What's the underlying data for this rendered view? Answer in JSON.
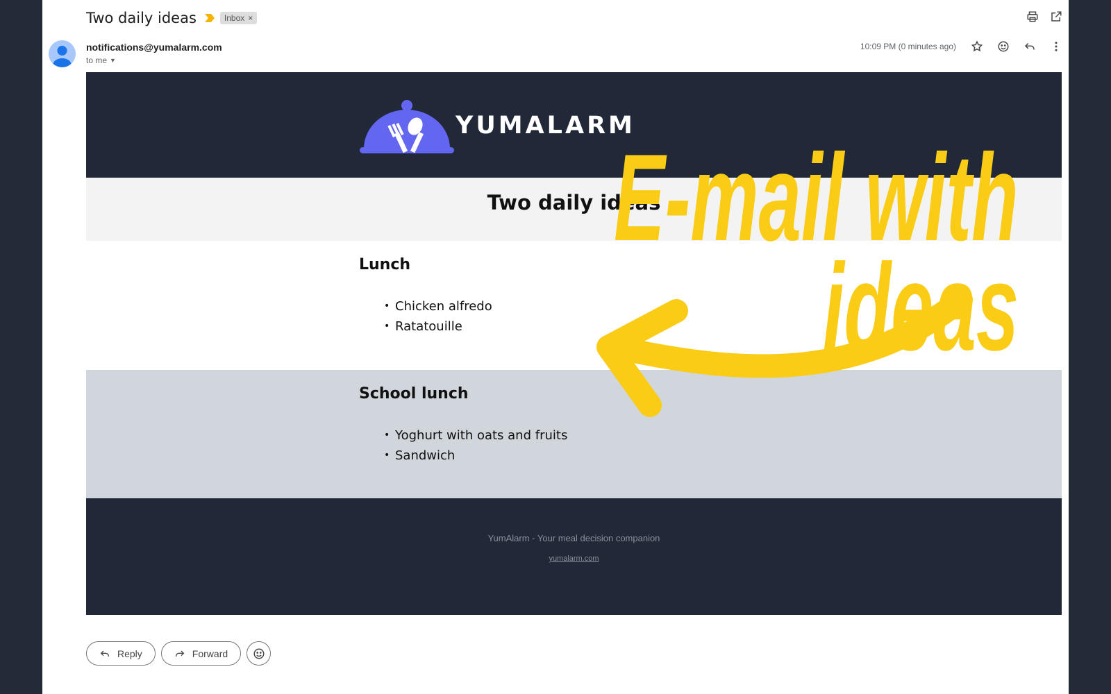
{
  "header": {
    "subject": "Two daily ideas",
    "label": "Inbox",
    "label_close": "×"
  },
  "sender": {
    "email": "notifications@yumalarm.com",
    "to": "to me",
    "timestamp": "10:09 PM (0 minutes ago)"
  },
  "email": {
    "brand": "YUMALARM",
    "title": "Two daily ideas",
    "sections": [
      {
        "heading": "Lunch",
        "items": [
          "Chicken alfredo",
          "Ratatouille"
        ]
      },
      {
        "heading": "School lunch",
        "items": [
          "Yoghurt with oats and fruits",
          "Sandwich"
        ]
      }
    ],
    "footer": {
      "tagline": "YumAlarm - Your meal decision companion",
      "link": "yumalarm.com"
    }
  },
  "overlay": {
    "line1": "E-mail with",
    "line2": "ideas",
    "color": "#facc15"
  },
  "actions": {
    "reply": "Reply",
    "forward": "Forward"
  },
  "colors": {
    "banner": "#212838",
    "logo_purple": "#6366f1",
    "school_band": "#d1d5dc"
  },
  "icons": [
    "importance-icon",
    "print-icon",
    "open-new-window-icon",
    "avatar-icon",
    "star-icon",
    "emoji-icon",
    "reply-icon",
    "more-vert-icon",
    "logo-cloche-icon",
    "forward-icon"
  ]
}
